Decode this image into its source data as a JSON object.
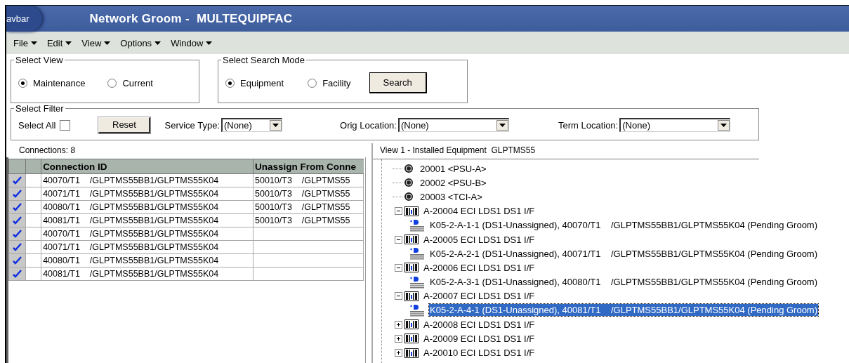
{
  "window": {
    "tab_label": "avbar",
    "title": "Network Groom -  MULTEQUIPFAC"
  },
  "menu": [
    "File",
    "Edit",
    "View",
    "Options",
    "Window"
  ],
  "select_view": {
    "title": "Select View",
    "options": [
      {
        "label": "Maintenance",
        "selected": true
      },
      {
        "label": "Current",
        "selected": false
      }
    ]
  },
  "search_mode": {
    "title": "Select Search Mode",
    "options": [
      {
        "label": "Equipment",
        "selected": true
      },
      {
        "label": "Facility",
        "selected": false
      }
    ],
    "button": "Search"
  },
  "filter": {
    "title": "Select Filter",
    "select_all": {
      "label": "Select All",
      "checked": false
    },
    "reset": "Reset",
    "dropdowns": [
      {
        "label": "Service Type:",
        "value": "(None)"
      },
      {
        "label": "Orig Location:",
        "value": "(None)"
      },
      {
        "label": "Term Location:",
        "value": "(None)"
      }
    ]
  },
  "connections": {
    "count_label": "Connections: 8",
    "columns": [
      "Connection ID",
      "Unassign From Conne"
    ],
    "rows": [
      {
        "checked": true,
        "connection_id": "40070/T1    /GLPTMS55BB1/GLPTMS55K04",
        "unassign_from": "50010/T3    /GLPTMS55"
      },
      {
        "checked": true,
        "connection_id": "40071/T1    /GLPTMS55BB1/GLPTMS55K04",
        "unassign_from": "50010/T3    /GLPTMS55"
      },
      {
        "checked": true,
        "connection_id": "40080/T1    /GLPTMS55BB1/GLPTMS55K04",
        "unassign_from": "50010/T3    /GLPTMS55"
      },
      {
        "checked": true,
        "connection_id": "40081/T1    /GLPTMS55BB1/GLPTMS55K04",
        "unassign_from": "50010/T3    /GLPTMS55"
      },
      {
        "checked": true,
        "connection_id": "40070/T1    /GLPTMS55BB1/GLPTMS55K04"
      },
      {
        "checked": true,
        "connection_id": "40071/T1    /GLPTMS55BB1/GLPTMS55K04"
      },
      {
        "checked": true,
        "connection_id": "40080/T1    /GLPTMS55BB1/GLPTMS55K04"
      },
      {
        "checked": true,
        "connection_id": "40081/T1    /GLPTMS55BB1/GLPTMS55K04"
      }
    ]
  },
  "tree": {
    "title": "View 1 - Installed Equipment  GLPTMS55",
    "items": [
      {
        "kind": "port",
        "label": "20001 <PSU-A>"
      },
      {
        "kind": "port",
        "label": "20002 <PSU-B>"
      },
      {
        "kind": "port",
        "label": "20003 <TCI-A>"
      },
      {
        "kind": "card",
        "label": "A-20004 ECI LDS1 DS1 I/F",
        "expanded": true,
        "children": [
          {
            "kind": "circuit",
            "label": "K05-2-A-1-1 (DS1-Unassigned), 40070/T1    /GLPTMS55BB1/GLPTMS55K04 (Pending Groom)",
            "selected": false
          }
        ]
      },
      {
        "kind": "card",
        "label": "A-20005 ECI LDS1 DS1 I/F",
        "expanded": true,
        "children": [
          {
            "kind": "circuit",
            "label": "K05-2-A-2-1 (DS1-Unassigned), 40071/T1    /GLPTMS55BB1/GLPTMS55K04 (Pending Groom)",
            "selected": false
          }
        ]
      },
      {
        "kind": "card",
        "label": "A-20006 ECI LDS1 DS1 I/F",
        "expanded": true,
        "children": [
          {
            "kind": "circuit",
            "label": "K05-2-A-3-1 (DS1-Unassigned), 40080/T1    /GLPTMS55BB1/GLPTMS55K04 (Pending Groom)",
            "selected": false
          }
        ]
      },
      {
        "kind": "card",
        "label": "A-20007 ECI LDS1 DS1 I/F",
        "expanded": true,
        "children": [
          {
            "kind": "circuit",
            "label": "K05-2-A-4-1 (DS1-Unassigned), 40081/T1    /GLPTMS55BB1/GLPTMS55K04 (Pending Groom)",
            "selected": true
          }
        ]
      },
      {
        "kind": "card",
        "label": "A-20008 ECI LDS1 DS1 I/F",
        "expanded": false
      },
      {
        "kind": "card",
        "label": "A-20009 ECI LDS1 DS1 I/F",
        "expanded": false
      },
      {
        "kind": "card",
        "label": "A-20010 ECI LDS1 DS1 I/F",
        "expanded": false
      }
    ]
  }
}
